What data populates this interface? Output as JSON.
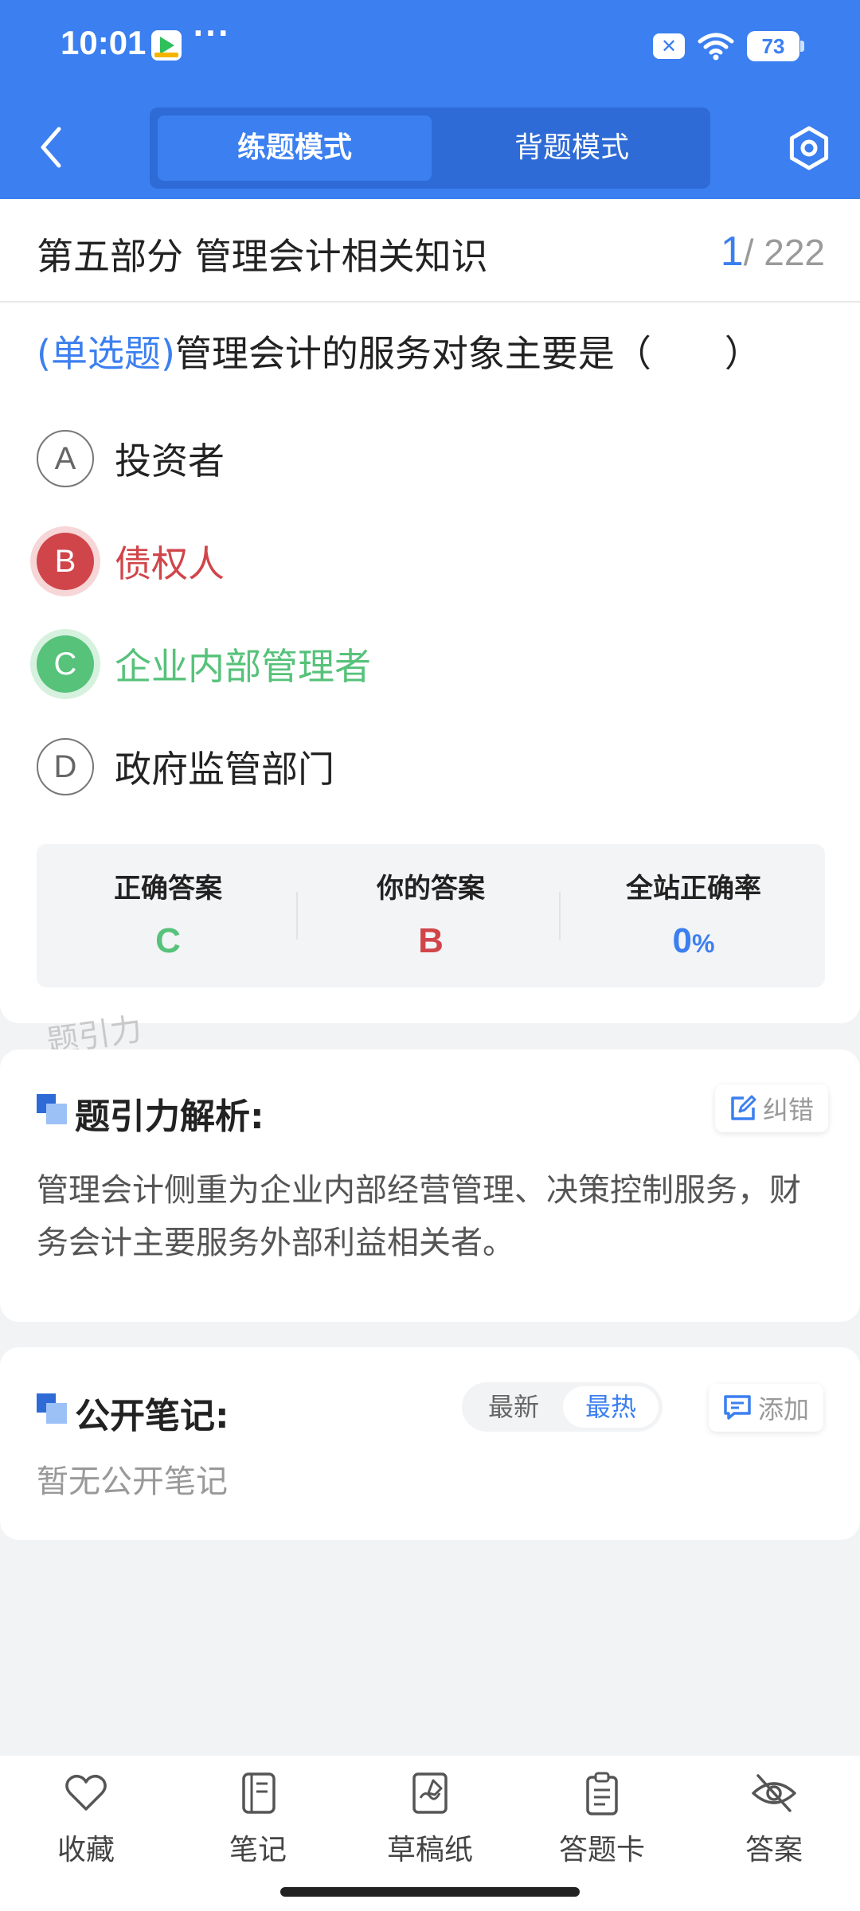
{
  "status_bar": {
    "time": "10:01",
    "more": "···",
    "battery": "73"
  },
  "header": {
    "modes": [
      {
        "label": "练题模式",
        "active": true
      },
      {
        "label": "背题模式",
        "active": false
      }
    ]
  },
  "question": {
    "section": "第五部分 管理会计相关知识",
    "current": "1",
    "total": "/ 222",
    "type": "(单选题)",
    "stem": "管理会计的服务对象主要是（　　）",
    "options": [
      {
        "letter": "A",
        "text": "投资者",
        "state": "normal"
      },
      {
        "letter": "B",
        "text": "债权人",
        "state": "wrong"
      },
      {
        "letter": "C",
        "text": "企业内部管理者",
        "state": "correct"
      },
      {
        "letter": "D",
        "text": "政府监管部门",
        "state": "normal"
      }
    ],
    "answer_box": {
      "correct_label": "正确答案",
      "correct_value": "C",
      "yours_label": "你的答案",
      "yours_value": "B",
      "rate_label": "全站正确率",
      "rate_value": "0",
      "rate_unit": "%"
    },
    "watermark": "题引力"
  },
  "analysis": {
    "title": "题引力解析:",
    "report_label": "纠错",
    "text": "管理会计侧重为企业内部经营管理、决策控制服务，财务会计主要服务外部利益相关者。"
  },
  "notes": {
    "title": "公开笔记:",
    "sort_latest": "最新",
    "sort_hottest": "最热",
    "add_label": "添加",
    "empty": "暂无公开笔记"
  },
  "bottom_nav": {
    "favorite": "收藏",
    "notes": "笔记",
    "scratch": "草稿纸",
    "answer_card": "答题卡",
    "answer": "答案"
  },
  "colors": {
    "primary": "#3b7ff0",
    "wrong": "#d0454a",
    "correct": "#56c27a"
  }
}
